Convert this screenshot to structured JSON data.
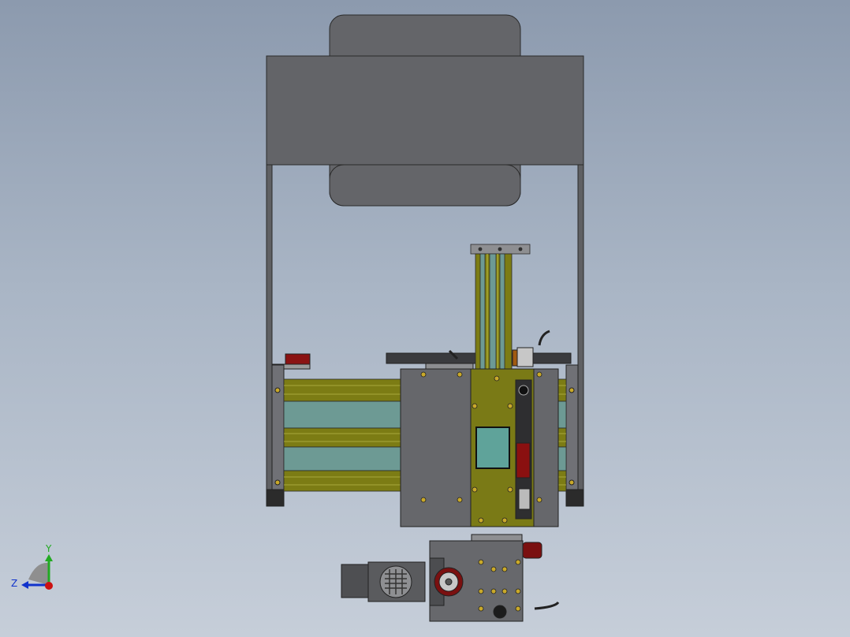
{
  "triad": {
    "y_label": "Y",
    "z_label": "Z",
    "x_color": "#cc1111",
    "y_color": "#22aa22",
    "z_color": "#1133cc"
  },
  "colors": {
    "background_top": "#8c9aae",
    "background_bottom": "#c6ced9",
    "frame": "#5f6063",
    "frame_edge": "#2a2a2a",
    "extrusion_olive": "#7d7d16",
    "panel_teal": "#6f9c96",
    "carriage_plate": "#66676b",
    "motor_red": "#8a1010",
    "window_teal": "#5fa39a"
  }
}
